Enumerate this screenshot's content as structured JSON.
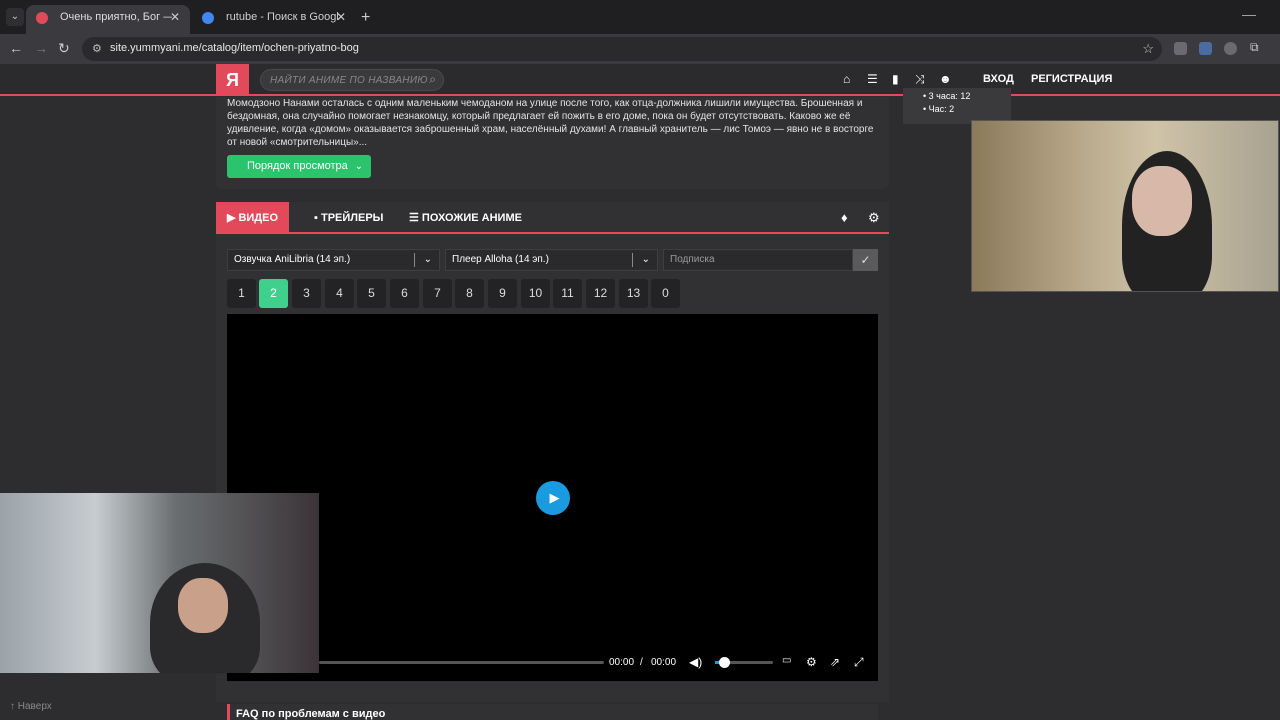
{
  "browser": {
    "tabs": [
      {
        "title": "Очень приятно, Бог — смотреть",
        "active": true,
        "favicon_color": "#e24a5c"
      },
      {
        "title": "rutube - Поиск в Google",
        "active": false,
        "favicon_color": "#4285f4"
      }
    ],
    "url": "site.yummyani.me/catalog/item/ochen-priyatno-bog"
  },
  "site": {
    "logo": "Я",
    "search_placeholder": "НАЙТИ АНИМЕ ПО НАЗВАНИЮ",
    "nav_icons": [
      "home-icon",
      "list-icon",
      "chart-icon",
      "shuffle-icon",
      "users-icon"
    ],
    "login": "ВХОД",
    "register": "РЕГИСТРАЦИЯ",
    "accent_color": "#e24a5c"
  },
  "description": {
    "text": "Момодзоно Нанами осталась с одним маленьким чемоданом на улице после того, как отца-должника лишили имущества. Брошенная и бездомная, она случайно помогает незнакомцу, который предлагает ей пожить в его доме, пока он будет отсутствовать. Каково же её удивление, когда «домом» оказывается заброшенный храм, населённый духами! А главный хранитель — лис Томоэ — явно не в восторге от новой «смотрительницы»...",
    "order_button": "Порядок просмотра"
  },
  "overlay_list": {
    "items": [
      "3 часа: 12",
      "Час: 2"
    ]
  },
  "video": {
    "tabs": {
      "video": "ВИДЕО",
      "trailers": "ТРЕЙЛЕРЫ",
      "similar": "ПОХОЖИЕ АНИМЕ"
    },
    "dub_select": "Озвучка AniLibria (14 эп.)",
    "player_select": "Плеер Alloha (14 эп.)",
    "subscribe_placeholder": "Подписка",
    "episodes": [
      "1",
      "2",
      "3",
      "4",
      "5",
      "6",
      "7",
      "8",
      "9",
      "10",
      "11",
      "12",
      "13",
      "0"
    ],
    "active_episode": "2",
    "current_time": "00:00",
    "separator": "/",
    "duration": "00:00",
    "volume": 0.1
  },
  "faq": "FAQ по проблемам с видео",
  "back_to_top": "↑ Наверх"
}
